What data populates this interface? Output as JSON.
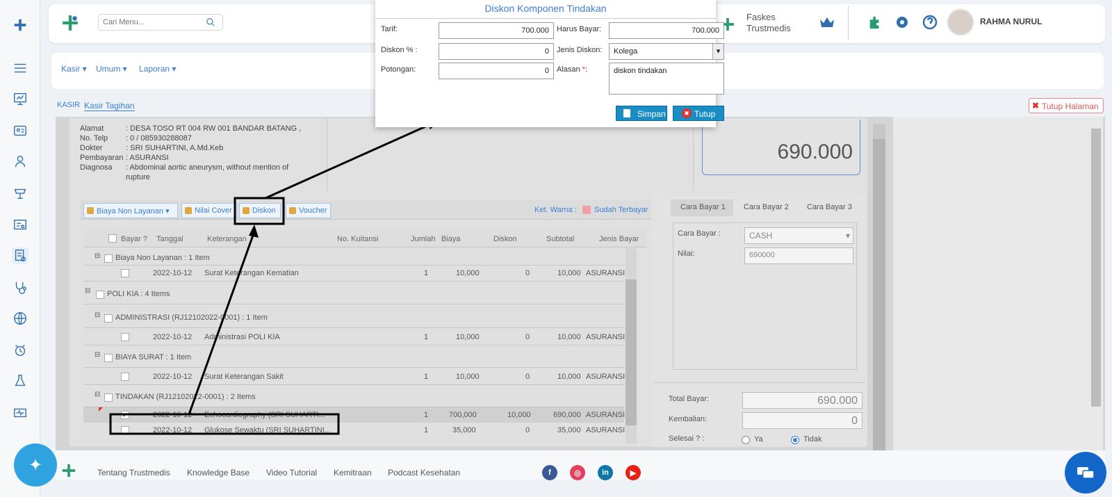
{
  "header": {
    "search_placeholder": "Cari Menu...",
    "facility": "Faskes\nTrustmedis",
    "facility_line1": "Faskes",
    "facility_line2": "Trustmedis",
    "user_name": "RAHMA NURUL"
  },
  "menubar": {
    "items": [
      "Kasir",
      "Umum",
      "Laporan"
    ]
  },
  "breadcrumb": {
    "section": "KASIR",
    "page": "Kasir Tagihan",
    "close_page": "Tutup Halaman"
  },
  "patient": {
    "alamat_label": "Alamat",
    "alamat": ": DESA TOSO RT 004 RW 001 BANDAR BATANG ,",
    "telp_label": "No. Telp",
    "telp": ": 0 / 085930288087",
    "dokter_label": "Dokter",
    "dokter": ": SRI SUHARTINI, A.Md.Keb",
    "pembayaran_label": "Pembayaran",
    "pembayaran": ": ASURANSI",
    "diagnosa_label": "Diagnosa",
    "diagnosa_line1": ": Abdominal aortic aneurysm, without mention of",
    "diagnosa_line2": "rupture"
  },
  "total_display": "690.000",
  "toolbar": {
    "biaya_non_layanan": "Biaya Non Layanan",
    "nilai_cover": "Nilai Cover",
    "diskon": "Diskon",
    "voucher": "Voucher",
    "ket_warna": "Ket. Warna :",
    "sudah_terbayar": "Sudah Terbayar"
  },
  "table": {
    "columns": [
      "Bayar ?",
      "Tanggal",
      "Keterangan",
      "No. Kuitansi",
      "Jumlah",
      "Biaya",
      "Diskon",
      "Subtotal",
      "Jenis Bayar"
    ],
    "groups": {
      "g1": "Biaya Non Layanan : 1 Item",
      "g2": "POLI KIA : 4 Items",
      "g3": "ADMINISTRASI (RJ12102022-0001) : 1 Item",
      "g4": "BIAYA SURAT : 1 Item",
      "g5": "TINDAKAN (RJ12102022-0001) : 2 Items"
    },
    "rows": [
      {
        "tanggal": "2022-10-12",
        "keterangan": "Surat Keterangan Kematian",
        "jumlah": "1",
        "biaya": "10,000",
        "diskon": "0",
        "subtotal": "10,000",
        "jenis": "ASURANSI"
      },
      {
        "tanggal": "2022-10-12",
        "keterangan": "Administrasi POLI KIA",
        "jumlah": "1",
        "biaya": "10,000",
        "diskon": "0",
        "subtotal": "10,000",
        "jenis": "ASURANSI"
      },
      {
        "tanggal": "2022-10-12",
        "keterangan": "Surat Keterangan Sakit",
        "jumlah": "1",
        "biaya": "10,000",
        "diskon": "0",
        "subtotal": "10,000",
        "jenis": "ASURANSI"
      },
      {
        "tanggal": "2022-10-12",
        "keterangan": "Echocardiography (SRI SUHARTI...",
        "jumlah": "1",
        "biaya": "700,000",
        "diskon": "10,000",
        "subtotal": "690,000",
        "jenis": "ASURANSI"
      },
      {
        "tanggal": "2022-10-12",
        "keterangan": "Glukose Sewaktu (SRI SUHARTINI...",
        "jumlah": "1",
        "biaya": "35,000",
        "diskon": "0",
        "subtotal": "35,000",
        "jenis": "ASURANSI"
      }
    ]
  },
  "payment": {
    "tabs": [
      "Cara Bayar 1",
      "Cara Bayar 2",
      "Cara Bayar 3"
    ],
    "cara_bayar_label": "Cara Bayar :",
    "cara_bayar_value": "CASH",
    "nilai_label": "Nilai:",
    "nilai_value": "690000",
    "total_bayar_label": "Total Bayar:",
    "total_bayar_value": "690.000",
    "kembalian_label": "Kembalian:",
    "kembalian_value": "0",
    "selesai_label": "Selesai ? :",
    "ya": "Ya",
    "tidak": "Tidak"
  },
  "dialog": {
    "title": "Diskon Komponen Tindakan",
    "tarif_label": "Tarif:",
    "tarif_value": "700.000",
    "harus_bayar_label": "Harus Bayar:",
    "harus_bayar_value": "700.000",
    "diskon_persen_label": "Diskon % :",
    "diskon_persen_value": "0",
    "jenis_diskon_label": "Jenis Diskon:",
    "jenis_diskon_value": "Kolega",
    "potongan_label": "Potongan:",
    "potongan_value": "0",
    "alasan_label": "Alasan",
    "alasan_required": "*",
    "alasan_suffix": ":",
    "alasan_value": "diskon tindakan",
    "simpan": "Simpan",
    "tutup": "Tutup"
  },
  "footer": {
    "links": [
      "Tentang Trustmedis",
      "Knowledge Base",
      "Video Tutorial",
      "Kemitraan",
      "Podcast Kesehatan"
    ]
  },
  "colors": {
    "accent": "#3b7fd4",
    "dialog_button": "#1a8ec4",
    "brand_green": "#2a9d6e"
  }
}
